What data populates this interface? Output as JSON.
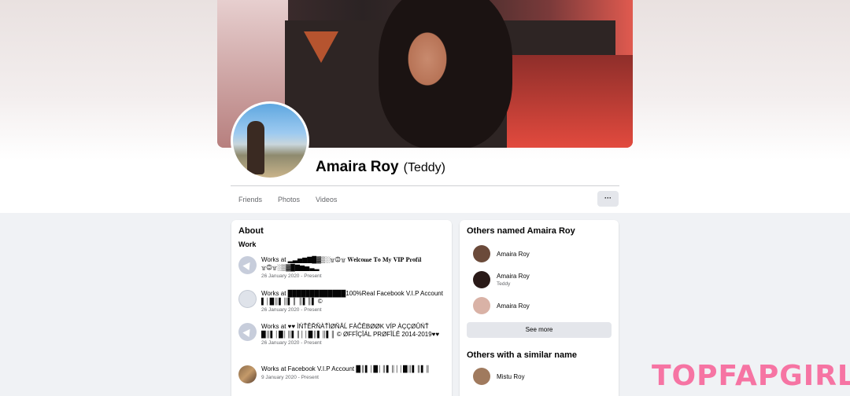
{
  "profile": {
    "name": "Amaira Roy",
    "alternate_name": "(Teddy)"
  },
  "tabs": [
    "Friends",
    "Photos",
    "Videos"
  ],
  "more_label": "···",
  "about": {
    "title": "About",
    "section": "Work",
    "items": [
      {
        "text": "Works at ▂▃▅▆▇█▓▒░۩۞۩ 𝐖𝐞𝐥𝐜𝐨𝐦𝐞 𝐓𝐨 𝐌𝐲 𝐕𝐈𝐏 𝐏𝐫𝐨𝐟𝐢𝐥 ۩۞۩░▒▓█▇▆▅▃▂",
        "date": "26 January 2020 - Present",
        "icon": "briefcase-icon"
      },
      {
        "text": "Works at █████████████100%Real Facebook V.I.P Account ▌│█║▌║▌║ ║▌║▌ ©",
        "date": "26 January 2020 - Present",
        "icon": "page-icon"
      },
      {
        "text": "Works at ♥♥ ÌŃŤÊŘŇÀŤÌØŇÂĹ FÀĈÊBØØK VÍP ÀÇÇØÛŃŤ █║▌│█│║▌║││█║▌║▌║ © ØFFÎÇÎÁL PRØFÎĹÊ 2014-2019♥♥",
        "date": "26 January 2020 - Present",
        "icon": "briefcase-icon"
      },
      {
        "text": "Works at Facebook V.I.P Account █║▌│█│║▌║││█║▌║▌║",
        "date": "9 January 2020 - Present",
        "icon": "photo-icon"
      }
    ]
  },
  "others_named": {
    "title": "Others named Amaira Roy",
    "people": [
      {
        "name": "Amaira Roy",
        "sub": "",
        "color": "#6b4a3a"
      },
      {
        "name": "Amaira Roy",
        "sub": "Teddy",
        "color": "#2a1a18"
      },
      {
        "name": "Amaira Roy",
        "sub": "",
        "color": "#d9b2a6"
      }
    ],
    "see_more": "See more"
  },
  "similar": {
    "title": "Others with a similar name",
    "people": [
      {
        "name": "Mistu Roy",
        "color": "#a07a5e"
      }
    ]
  },
  "watermark": "TOPFAPGIRLS"
}
